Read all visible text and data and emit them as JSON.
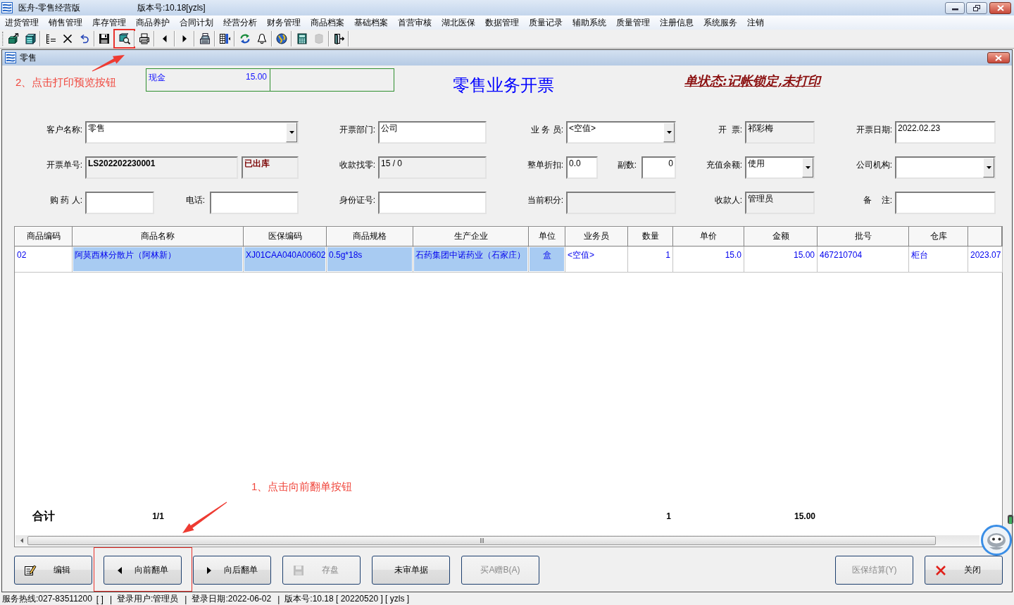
{
  "window": {
    "title": "医舟-零售经营版",
    "version": "版本号:10.18[yzls]"
  },
  "menu": [
    "进货管理",
    "销售管理",
    "库存管理",
    "商品养护",
    "合同计划",
    "经营分析",
    "财务管理",
    "商品档案",
    "基础档案",
    "首营审核",
    "湖北医保",
    "数据管理",
    "质量记录",
    "辅助系统",
    "质量管理",
    "注册信息",
    "系统服务",
    "注销"
  ],
  "toolbar": [
    [
      {
        "kind": "new",
        "disabled": false,
        "highlighted": false
      },
      {
        "kind": "open",
        "disabled": false,
        "highlighted": false
      }
    ],
    [
      {
        "kind": "list",
        "disabled": false,
        "highlighted": false
      },
      {
        "kind": "delete",
        "disabled": false,
        "highlighted": false
      },
      {
        "kind": "undo",
        "disabled": false,
        "highlighted": false
      }
    ],
    [
      {
        "kind": "save",
        "disabled": false,
        "highlighted": false
      }
    ],
    [
      {
        "kind": "preview",
        "disabled": false,
        "highlighted": true
      }
    ],
    [
      {
        "kind": "print",
        "disabled": false,
        "highlighted": false
      }
    ],
    [
      {
        "kind": "prev",
        "disabled": false,
        "highlighted": false
      }
    ],
    [
      {
        "kind": "next",
        "disabled": false,
        "highlighted": false
      }
    ],
    [
      {
        "kind": "register",
        "disabled": false,
        "highlighted": false
      }
    ],
    [
      {
        "kind": "columns",
        "disabled": false,
        "highlighted": false
      }
    ],
    [
      {
        "kind": "refresh",
        "disabled": false,
        "highlighted": false
      },
      {
        "kind": "bell",
        "disabled": false,
        "highlighted": false
      }
    ],
    [
      {
        "kind": "globe",
        "disabled": false,
        "highlighted": false
      }
    ],
    [
      {
        "kind": "calculator",
        "disabled": false,
        "highlighted": false
      },
      {
        "kind": "blank",
        "disabled": true,
        "highlighted": false
      }
    ],
    [
      {
        "kind": "exit",
        "disabled": false,
        "highlighted": false
      }
    ]
  ],
  "document_window": {
    "title": "零售"
  },
  "payments": [
    {
      "method": "现金",
      "amount": "15.00"
    }
  ],
  "invoice": {
    "title": "零售业务开票",
    "status": "单状态:记帐锁定,未打印"
  },
  "form": {
    "rows": [
      {
        "sections": [
          {
            "label": "客户名称:",
            "fields": [
              {
                "kind": "combo",
                "value": "零售"
              }
            ]
          },
          {
            "label": "开票部门:",
            "fields": [
              {
                "kind": "input",
                "value": "公司"
              }
            ]
          },
          {
            "label": "业 务 员:",
            "fields": [
              {
                "kind": "combo",
                "value": "<空值>"
              }
            ]
          },
          {
            "label": "开  票:",
            "fields": [
              {
                "kind": "readonly",
                "value": "祁彩梅"
              }
            ]
          },
          {
            "label": "开票日期:",
            "fields": [
              {
                "kind": "input",
                "value": "2022.02.23"
              }
            ]
          }
        ]
      },
      {
        "sections": [
          {
            "label": "开票单号:",
            "fields": [
              {
                "kind": "docno",
                "value": "LS202202230001"
              },
              {
                "kind": "stockstate",
                "value": "已出库"
              }
            ]
          },
          {
            "label": "收款找零:",
            "fields": [
              {
                "kind": "readonly",
                "value": "15 / 0"
              }
            ]
          },
          {
            "label": "整单折扣:",
            "fields": [
              {
                "kind": "input",
                "value": "0.0"
              },
              {
                "kind": "label",
                "text": "副数:"
              },
              {
                "kind": "number",
                "value": "0"
              }
            ]
          },
          {
            "label": "充值余额:",
            "fields": [
              {
                "kind": "combo",
                "value": "使用"
              }
            ]
          },
          {
            "label": "公司机构:",
            "fields": [
              {
                "kind": "combo"
              }
            ]
          }
        ]
      },
      {
        "sections": [
          {
            "label": "购 药 人:",
            "fields": [
              {
                "kind": "input"
              },
              {
                "kind": "label",
                "text": "电话:"
              },
              {
                "kind": "input"
              }
            ]
          },
          {
            "label": "身份证号:",
            "fields": [
              {
                "kind": "input"
              }
            ]
          },
          {
            "label": "当前积分:",
            "fields": [
              {
                "kind": "readonly"
              }
            ]
          },
          {
            "label": "收款人:",
            "fields": [
              {
                "kind": "readonly",
                "value": "管理员"
              }
            ]
          },
          {
            "label": "备    注:",
            "fields": [
              {
                "kind": "input"
              }
            ]
          }
        ]
      }
    ]
  },
  "table": {
    "columns": [
      "商品编码",
      "商品名称",
      "医保编码",
      "商品规格",
      "生产企业",
      "单位",
      "业务员",
      "数量",
      "单价",
      "金额",
      "批号",
      "仓库"
    ],
    "rows": [
      {
        "cells": [
          {
            "text": "02",
            "highlighted": false
          },
          {
            "text": "阿莫西林分散片（阿林新）",
            "highlighted": true
          },
          {
            "text": "XJ01CAA040A00602",
            "highlighted": true
          },
          {
            "text": "0.5g*18s",
            "highlighted": true
          },
          {
            "text": "石药集团中诺药业（石家庄）",
            "highlighted": true
          },
          {
            "text": "盒",
            "highlighted": true
          },
          {
            "text": "<空值>",
            "highlighted": false
          },
          {
            "text": "1",
            "highlighted": false
          },
          {
            "text": "15.0",
            "highlighted": false
          },
          {
            "text": "15.00",
            "highlighted": false
          },
          {
            "text": "467210704",
            "highlighted": false
          },
          {
            "text": "柜台",
            "highlighted": false
          },
          {
            "text": "2023.07",
            "highlighted": false
          }
        ]
      }
    ]
  },
  "totals": {
    "label": "合计",
    "pages": "1/1",
    "quantity": "1",
    "amount": "15.00"
  },
  "actions": {
    "left": [
      {
        "label": "编辑",
        "kind": "edit",
        "disabled": false,
        "highlighted": false
      },
      {
        "label": "向前翻单",
        "kind": "prev",
        "disabled": false,
        "highlighted": true
      },
      {
        "label": "向后翻单",
        "kind": "next",
        "disabled": false,
        "highlighted": false
      },
      {
        "label": "存盘",
        "kind": "save",
        "disabled": true,
        "highlighted": false
      },
      {
        "label": "未审单据",
        "kind": "plain",
        "disabled": false,
        "highlighted": false
      },
      {
        "label": "买A赠B(A)",
        "kind": "plain",
        "disabled": true,
        "highlighted": false
      }
    ],
    "right": [
      {
        "label": "医保结算(Y)",
        "kind": "plain",
        "disabled": true,
        "highlighted": false
      },
      {
        "label": "关闭",
        "kind": "close",
        "disabled": false,
        "highlighted": false
      }
    ]
  },
  "status_bar": [
    {
      "kind": "text",
      "text": "服务热线:027-83511200"
    },
    {
      "kind": "text",
      "text": "[ ]"
    },
    {
      "kind": "separator",
      "text": "|"
    },
    {
      "kind": "text",
      "text": "登录用户:管理员"
    },
    {
      "kind": "separator",
      "text": "|"
    },
    {
      "kind": "text",
      "text": "登录日期:2022-06-02"
    },
    {
      "kind": "separator",
      "text": "|"
    },
    {
      "kind": "text",
      "text": "版本号:10.18 [ 20220520 ] [ yzls ]"
    }
  ],
  "annotations": [
    {
      "text": "2、点击打印预览按钮"
    },
    {
      "text": "1、点击向前翻单按钮"
    }
  ]
}
